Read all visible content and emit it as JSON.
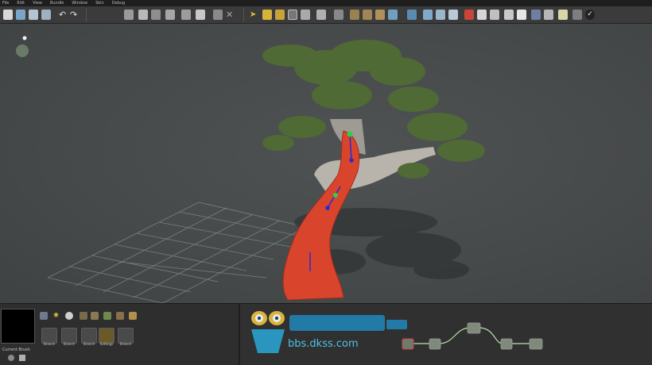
{
  "menu": [
    "File",
    "Edit",
    "View",
    "Bundle",
    "Window",
    "Skin",
    "Debug"
  ],
  "toolbar": {
    "groups": [
      [
        "new-file",
        "open-file",
        "save-file",
        "save-as",
        "undo",
        "redo"
      ],
      [
        "select-all",
        "copy",
        "paste",
        "snap",
        "refresh",
        "stop",
        "delete"
      ],
      [
        "pointer",
        "pen",
        "pencil",
        "ruler",
        "scissors",
        "grid",
        "branch-tool",
        "leaf-tool",
        "twig-tool",
        "frond-tool",
        "mesh-tool",
        "fin-tool",
        "bone-tool",
        "cut-tool",
        "lod-tool",
        "collision-tool",
        "material",
        "texture",
        "wind",
        "light",
        "camera",
        "render-stats",
        "check"
      ]
    ]
  },
  "viewport": {
    "colors": {
      "background": "#4a4d4e",
      "grid": "#8a8d8e",
      "brush_selection": "#d63b25",
      "gizmo": "#2a2ad0",
      "node": "#2bd24a"
    }
  },
  "bottom": {
    "brush_label": "Current Brush",
    "brush_slots": [
      "Branch",
      "Branch",
      "Branch",
      "Settings",
      "Branch"
    ]
  },
  "graph": {
    "watermark_domain": "bbs.dkss.com"
  }
}
